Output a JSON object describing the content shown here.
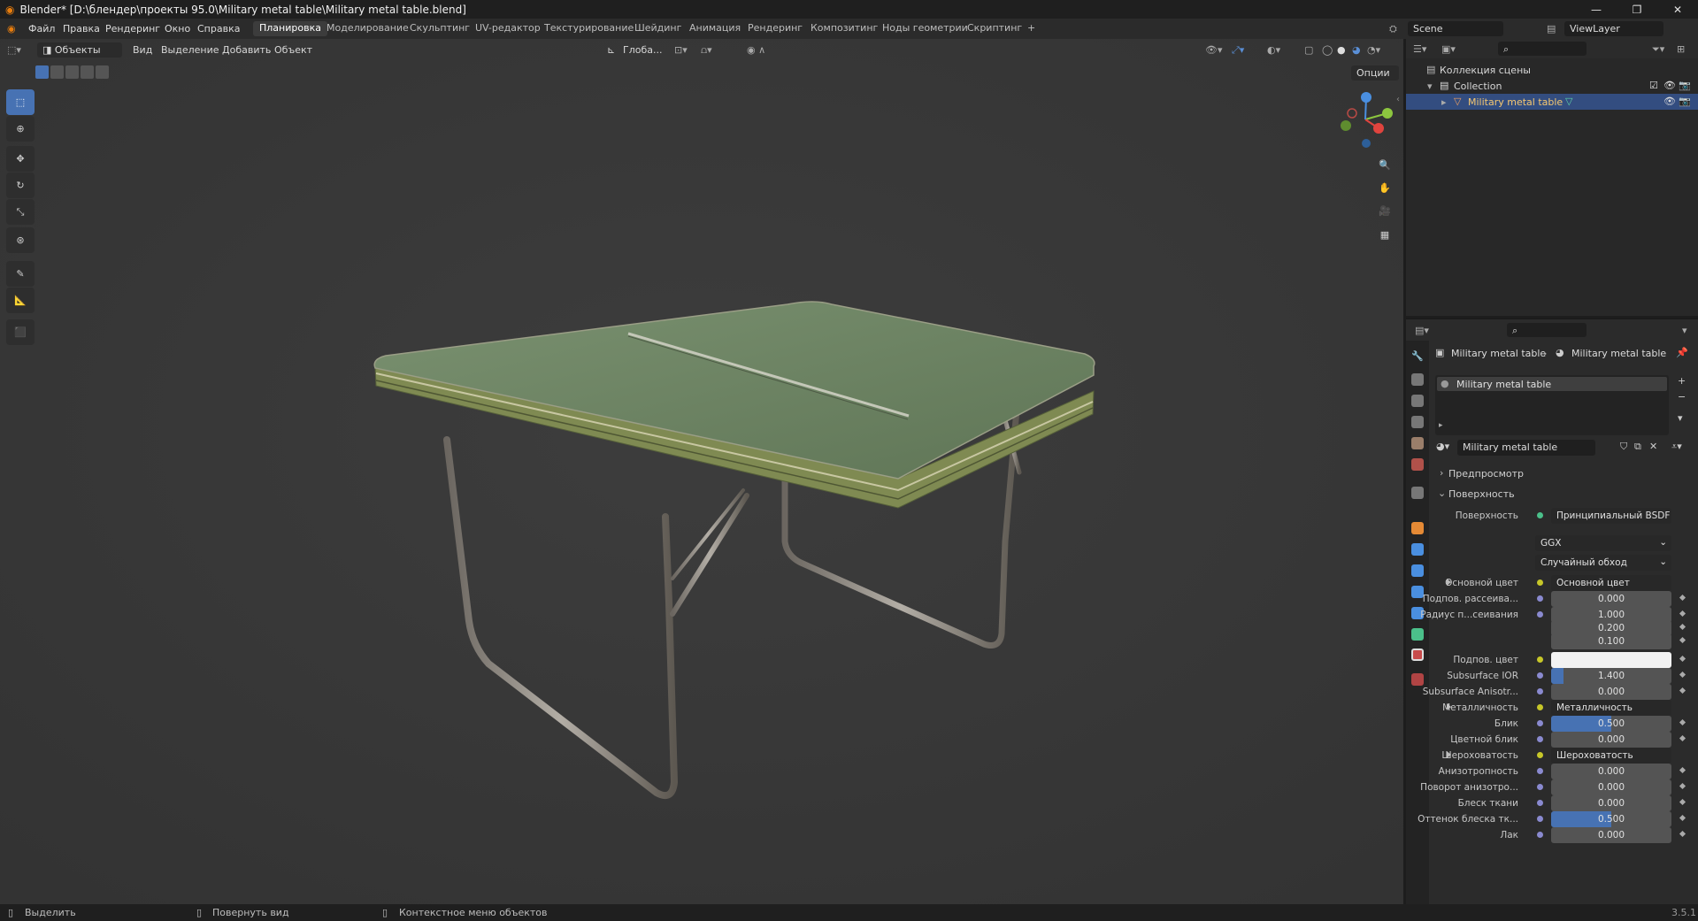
{
  "app": {
    "title": "Blender* [D:\\блендер\\проекты 95.0\\Military metal table\\Military metal table.blend]",
    "version": "3.5.1"
  },
  "menu": [
    "Файл",
    "Правка",
    "Рендеринг",
    "Окно",
    "Справка"
  ],
  "workspaces": [
    {
      "label": "Планировка",
      "active": true
    },
    {
      "label": "Моделирование"
    },
    {
      "label": "Скульптинг"
    },
    {
      "label": "UV-редактор"
    },
    {
      "label": "Текстурирование"
    },
    {
      "label": "Шейдинг"
    },
    {
      "label": "Анимация"
    },
    {
      "label": "Рендеринг"
    },
    {
      "label": "Композитинг"
    },
    {
      "label": "Ноды геометрии"
    },
    {
      "label": "Скриптинг"
    }
  ],
  "scene": {
    "name": "Scene",
    "view_layer": "ViewLayer"
  },
  "viewport_header": {
    "mode": "Объекты",
    "menus": [
      "Вид",
      "Выделение",
      "Добавить",
      "Объект"
    ],
    "orientation": "Глоба...",
    "options": "Опции"
  },
  "outliner": {
    "scene_collection": "Коллекция сцены",
    "collection": "Collection",
    "object": "Military metal table"
  },
  "properties": {
    "breadcrumb_object": "Military metal table",
    "breadcrumb_material": "Military metal table",
    "slot": "Military metal table",
    "material_name": "Military metal table",
    "section_preview": "Предпросмотр",
    "section_surface": "Поверхность",
    "surface_label": "Поверхность",
    "surface_value": "Принципиальный BSDF",
    "distribution": "GGX",
    "subsurface_method": "Случайный обход",
    "rows": [
      {
        "label": "Основной цвет",
        "value": "Основной цвет",
        "kind": "link",
        "expand": true
      },
      {
        "label": "Подпов. рассеива...",
        "value": "0.000",
        "kind": "num"
      },
      {
        "label": "Радиус п...сеивания",
        "value": "1.000",
        "kind": "num"
      },
      {
        "label": "",
        "value": "0.200",
        "kind": "num"
      },
      {
        "label": "",
        "value": "0.100",
        "kind": "num"
      },
      {
        "label": "Подпов. цвет",
        "value": "",
        "kind": "color"
      },
      {
        "label": "Subsurface IOR",
        "value": "1.400",
        "kind": "num",
        "fill": 0.1
      },
      {
        "label": "Subsurface Anisotr...",
        "value": "0.000",
        "kind": "num"
      },
      {
        "label": "Металличность",
        "value": "Металличность",
        "kind": "link",
        "expand": true
      },
      {
        "label": "Блик",
        "value": "0.500",
        "kind": "num",
        "fill": 0.5
      },
      {
        "label": "Цветной блик",
        "value": "0.000",
        "kind": "num"
      },
      {
        "label": "Шероховатость",
        "value": "Шероховатость",
        "kind": "link",
        "expand": true
      },
      {
        "label": "Анизотропность",
        "value": "0.000",
        "kind": "num"
      },
      {
        "label": "Поворот анизотро...",
        "value": "0.000",
        "kind": "num"
      },
      {
        "label": "Блеск ткани",
        "value": "0.000",
        "kind": "num"
      },
      {
        "label": "Оттенок блеска тк...",
        "value": "0.500",
        "kind": "num",
        "fill": 0.5
      },
      {
        "label": "Лак",
        "value": "0.000",
        "kind": "num"
      }
    ]
  },
  "statusbar": {
    "select": "Выделить",
    "rotate": "Повернуть вид",
    "context": "Контекстное меню объектов"
  },
  "colors": {
    "accent": "#4772b3",
    "selection": "#334d80",
    "viewport_bg": "#3b3b3b",
    "table_top": "#6e8663"
  }
}
